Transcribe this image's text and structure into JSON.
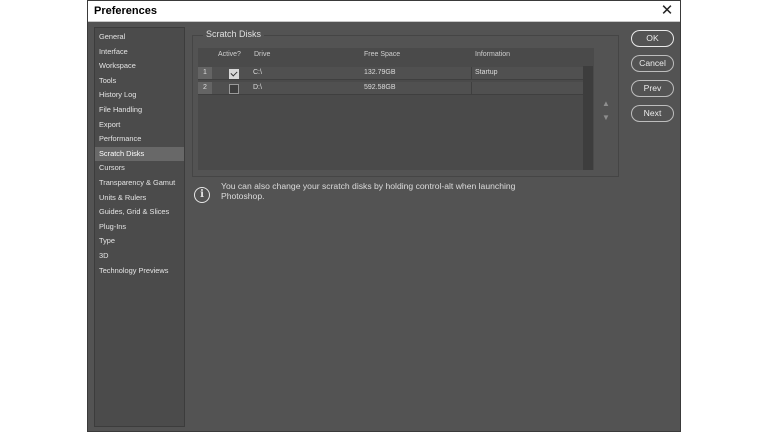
{
  "window": {
    "title": "Preferences",
    "close_glyph": "✕"
  },
  "sidebar": {
    "items": [
      {
        "label": "General"
      },
      {
        "label": "Interface"
      },
      {
        "label": "Workspace"
      },
      {
        "label": "Tools"
      },
      {
        "label": "History Log"
      },
      {
        "label": "File Handling"
      },
      {
        "label": "Export"
      },
      {
        "label": "Performance"
      },
      {
        "label": "Scratch Disks",
        "selected": true
      },
      {
        "label": "Cursors"
      },
      {
        "label": "Transparency & Gamut"
      },
      {
        "label": "Units & Rulers"
      },
      {
        "label": "Guides, Grid & Slices"
      },
      {
        "label": "Plug-Ins"
      },
      {
        "label": "Type"
      },
      {
        "label": "3D"
      },
      {
        "label": "Technology Previews"
      }
    ]
  },
  "scratch_disks": {
    "title": "Scratch Disks",
    "columns": [
      "Active?",
      "Drive",
      "Free Space",
      "Information"
    ],
    "rows": [
      {
        "num": "1",
        "active": true,
        "drive": "C:\\",
        "free_space": "132.79GB",
        "information": "Startup"
      },
      {
        "num": "2",
        "active": false,
        "drive": "D:\\",
        "free_space": "592.58GB",
        "information": ""
      }
    ],
    "move_up_glyph": "▲",
    "move_down_glyph": "▼"
  },
  "info": {
    "icon": "info-icon",
    "glyph": "i",
    "text": "You can also change your scratch disks by holding control-alt when launching Photoshop."
  },
  "buttons": {
    "ok": "OK",
    "cancel": "Cancel",
    "prev": "Prev",
    "next": "Next"
  }
}
